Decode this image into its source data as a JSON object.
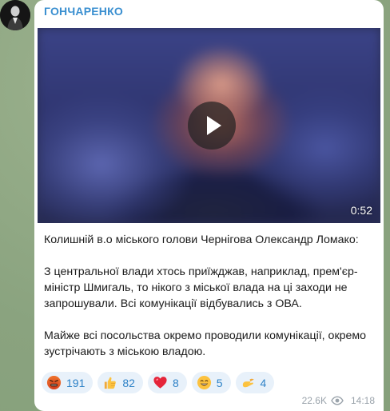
{
  "channel": {
    "sender_name": "ГОНЧАРЕНКО",
    "avatar_icon": "avatar-silhouette"
  },
  "video": {
    "duration": "0:52",
    "play_icon": "play-icon"
  },
  "message": {
    "paragraphs": [
      "Колишній в.о міського голови Чернігова Олександр Ломако:",
      "З центральної влади хтось приїжджав, наприклад, прем'єр-міністр Шмигаль, то нікого з міської влада на ці заходи не запрошували. Всі комунікації відбувались з ОВА.",
      "Майже всі посольства окремо проводили комунікації, окремо зустрічають з міською владою."
    ]
  },
  "reactions": [
    {
      "icon": "angry-face-icon",
      "count": "191"
    },
    {
      "icon": "thumbs-up-icon",
      "count": "82"
    },
    {
      "icon": "heart-icon",
      "count": "8"
    },
    {
      "icon": "grinning-face-icon",
      "count": "5"
    },
    {
      "icon": "pinching-hand-icon",
      "count": "4"
    }
  ],
  "footer": {
    "views": "22.6K",
    "views_icon": "eye-icon",
    "time": "14:18"
  },
  "colors": {
    "sender": "#3a8fd0",
    "reaction_bg": "#e8f1fa",
    "reaction_text": "#2e82c7",
    "meta_text": "#9aa3ab"
  }
}
